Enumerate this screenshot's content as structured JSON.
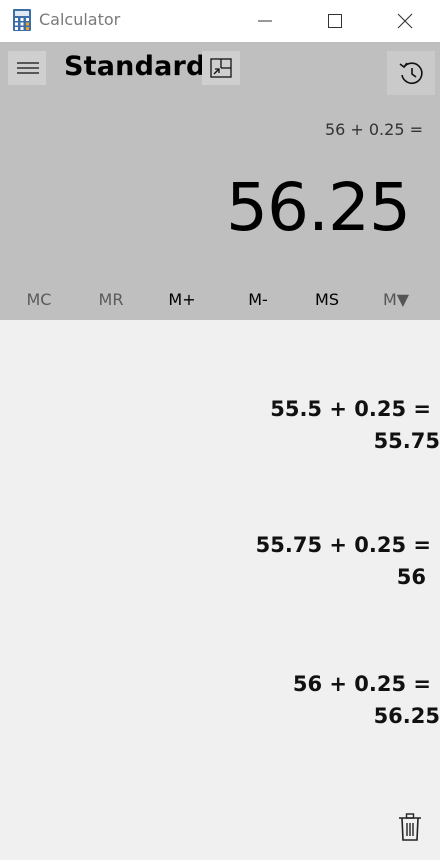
{
  "window": {
    "title": "Calculator",
    "icon": "calculator-app-icon",
    "controls": [
      "minimize-icon",
      "maximize-icon",
      "close-icon"
    ]
  },
  "header": {
    "mode": "Standard",
    "menu_icon": "hamburger-icon",
    "keep_on_top_icon": "keep-on-top-icon",
    "history_icon": "history-icon"
  },
  "display": {
    "expression": "56 + 0.25 =",
    "result": "56.25"
  },
  "memory": {
    "buttons": [
      {
        "label": "MC",
        "enabled": false
      },
      {
        "label": "MR",
        "enabled": false
      },
      {
        "label": "M+",
        "enabled": true
      },
      {
        "label": "M-",
        "enabled": true
      },
      {
        "label": "MS",
        "enabled": true
      },
      {
        "label": "M▼",
        "enabled": false
      }
    ]
  },
  "history": {
    "items": [
      {
        "expression": "55.5 + 0.25 =",
        "result": "55.75"
      },
      {
        "expression": "55.75 + 0.25 =",
        "result": "56"
      },
      {
        "expression": "56 + 0.25 =",
        "result": "56.25"
      }
    ],
    "clear_icon": "trash-icon"
  },
  "colors": {
    "title_bar": "#ffffff",
    "display_bg": "#bfbfbf",
    "history_bg": "#f0f0f0",
    "text": "#000000"
  }
}
